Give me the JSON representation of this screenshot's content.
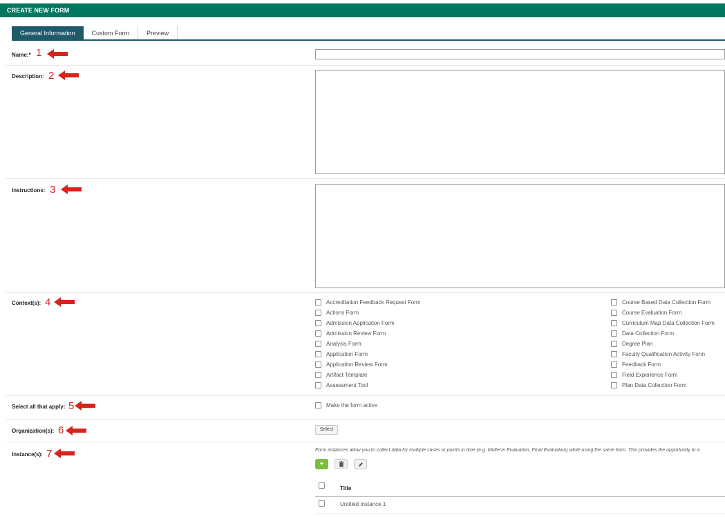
{
  "header": {
    "title": "CREATE NEW FORM"
  },
  "tabs": [
    {
      "label": "General Information",
      "active": true
    },
    {
      "label": "Custom Form",
      "active": false
    },
    {
      "label": "Preview",
      "active": false
    }
  ],
  "fields": {
    "name": {
      "label": "Name:*",
      "value": "",
      "annotation": "1"
    },
    "description": {
      "label": "Description:",
      "value": "",
      "annotation": "2"
    },
    "instructions": {
      "label": "Instructions:",
      "value": "",
      "annotation": "3"
    },
    "contexts": {
      "label": "Context(s):",
      "annotation": "4"
    },
    "select_all": {
      "label": "Select all that apply:",
      "annotation": "5",
      "option": "Make the form active",
      "checked": false
    },
    "organizations": {
      "label": "Organization(s):",
      "annotation": "6",
      "button": "Select"
    },
    "instances": {
      "label": "Instance(s):",
      "annotation": "7"
    }
  },
  "contexts_left": [
    "Accreditation Feedback Request Form",
    "Actions Form",
    "Admission Application Form",
    "Admission Review Form",
    "Analysis Form",
    "Application Form",
    "Application Review Form",
    "Artifact Template",
    "Assessment Tool"
  ],
  "contexts_right": [
    "Course Based Data Collection Form",
    "Course Evaluation Form",
    "Curriculum Map Data Collection Form",
    "Data Collection Form",
    "Degree Plan",
    "Faculty Qualification Activity Form",
    "Feedback Form",
    "Field Experience Form",
    "Plan Data Collection Form"
  ],
  "instances": {
    "hint": "Form instances allow you to collect data for multiple cases or points in time (e.g. Midterm Evaluation, Final Evaluation) while using the same form. This provides the opportunity to a",
    "add_label": "+",
    "table": {
      "header": "Title",
      "rows": [
        "Untitled Instance 1"
      ]
    }
  },
  "colors": {
    "header_bg": "#00775f",
    "active_tab_bg": "#1f5a6b",
    "annotation_red": "#d6231c",
    "add_button_green": "#7dbb43"
  }
}
